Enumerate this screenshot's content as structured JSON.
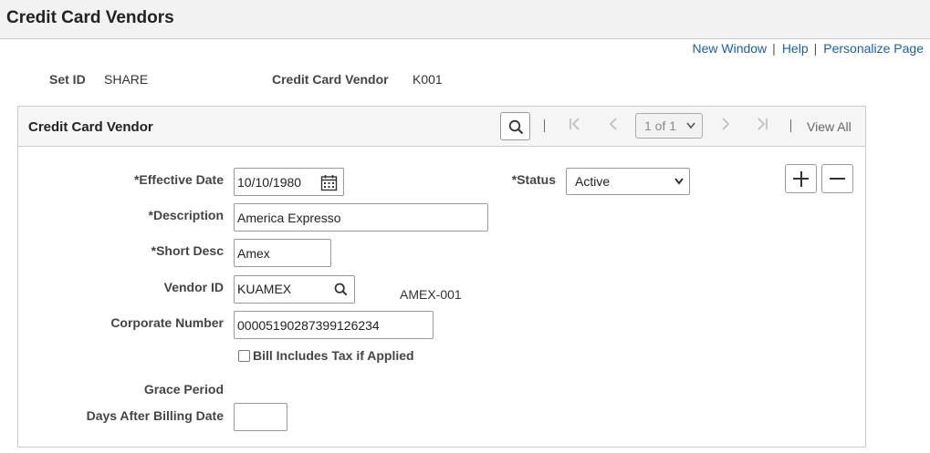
{
  "page": {
    "title": "Credit Card Vendors"
  },
  "toplinks": {
    "new_window": "New Window",
    "sep": "|",
    "help": "Help",
    "personalize": "Personalize Page"
  },
  "header": {
    "setid_label": "Set ID",
    "setid_value": "SHARE",
    "vendor_label": "Credit Card Vendor",
    "vendor_value": "K001"
  },
  "panel": {
    "title": "Credit Card Vendor",
    "pager": {
      "sep": "|",
      "first": "|<",
      "prev": "<",
      "range": "1 of 1",
      "next": ">",
      "last": ">|",
      "view_all": "View All"
    }
  },
  "form": {
    "effective_date": {
      "label": "*Effective Date",
      "value": "10/10/1980"
    },
    "status": {
      "label": "*Status",
      "value": "Active"
    },
    "description": {
      "label": "*Description",
      "value": "America Expresso"
    },
    "short_desc": {
      "label": "*Short Desc",
      "value": "Amex"
    },
    "vendor_id": {
      "label": "Vendor ID",
      "value": "KUAMEX",
      "display": "AMEX-001"
    },
    "corporate_number": {
      "label": "Corporate Number",
      "value": "00005190287399126234"
    },
    "bill_includes_tax": {
      "label": "Bill Includes Tax if Applied",
      "checked": false
    },
    "grace_period": {
      "label": "Grace Period"
    },
    "days_after_billing": {
      "label": "Days After Billing Date",
      "value": ""
    }
  },
  "icons": {
    "search": "search-icon",
    "calendar": "calendar-icon",
    "add": "plus-icon",
    "delete": "minus-icon"
  },
  "colors": {
    "link": "#1a5fa8",
    "title_bar": "#f2f2f2",
    "panel_head": "#f5f5f5"
  }
}
